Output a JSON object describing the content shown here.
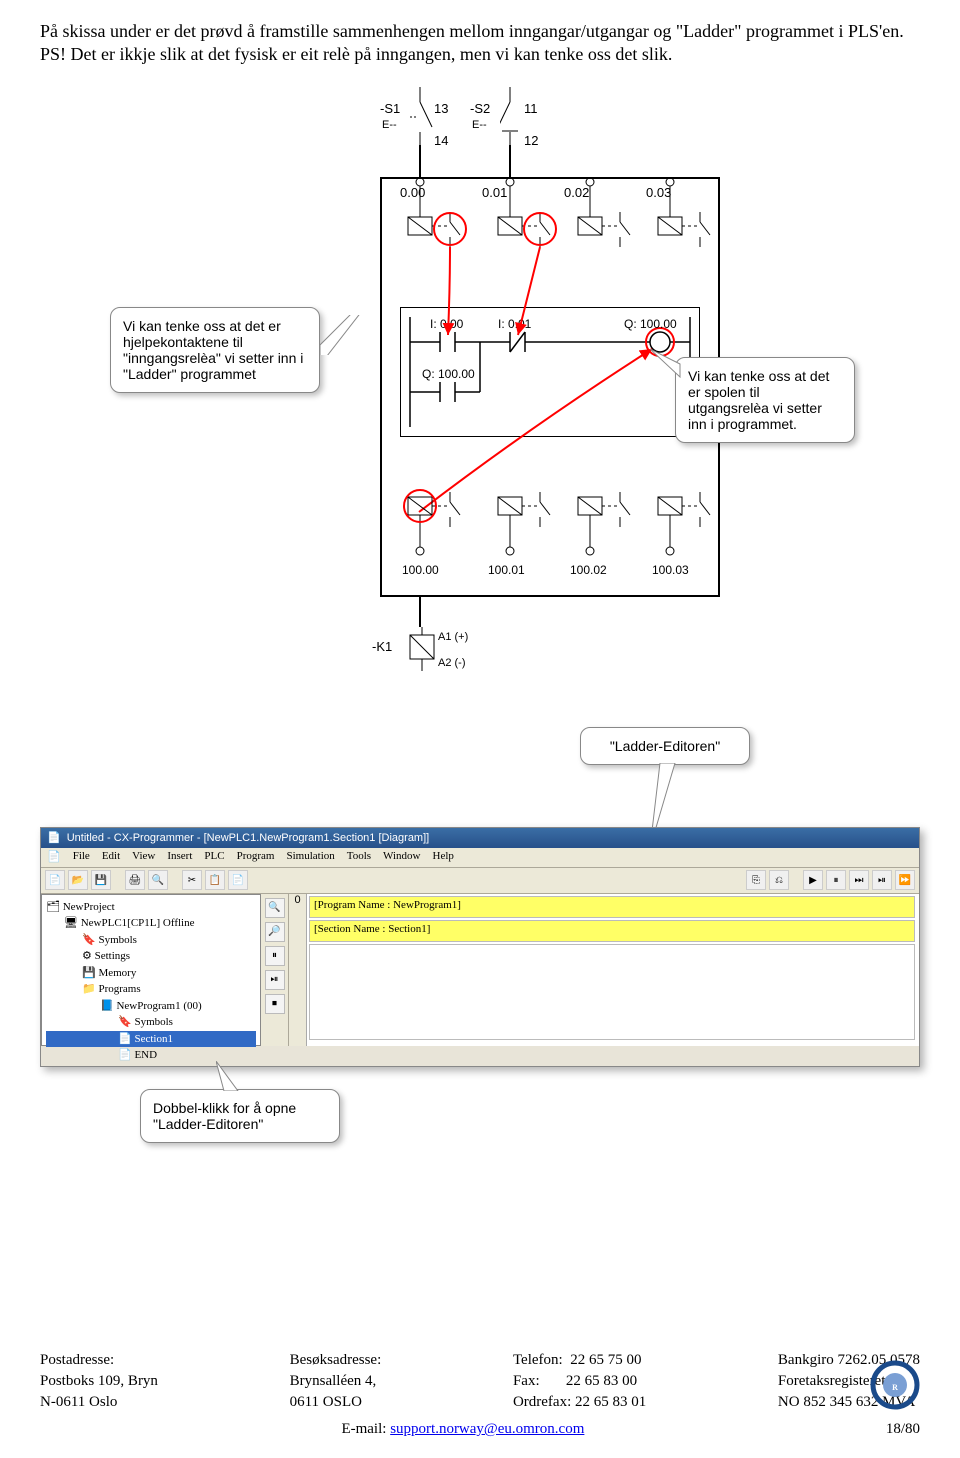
{
  "intro": {
    "p1": "På skissa under er det prøvd å framstille sammenhengen mellom inngangar/utgangar og \"Ladder\" programmet i PLS'en.",
    "p2": "PS! Det er ikkje slik at det fysisk er eit relè på inngangen, men vi kan tenke oss det slik."
  },
  "circuit": {
    "top_switches": [
      {
        "name": "-S1",
        "pins": [
          "13",
          "14"
        ],
        "sym": "E--"
      },
      {
        "name": "-S2",
        "pins": [
          "11",
          "12"
        ],
        "sym": "E--"
      }
    ],
    "input_terminals": [
      "0.00",
      "0.01",
      "0.02",
      "0.03"
    ],
    "output_terminals": [
      "100.00",
      "100.01",
      "100.02",
      "100.03"
    ],
    "ladder": {
      "contacts": [
        "I: 0.00",
        "I: 0.01"
      ],
      "coil": "Q: 100.00",
      "branch_contact": "Q: 100.00"
    },
    "bottom_device": {
      "name": "-K1",
      "pins": [
        "A1 (+)",
        "A2 (-)"
      ]
    }
  },
  "callouts": {
    "left": "Vi kan tenke oss at det er hjelpekontaktene til \"inngangsrelèa\" vi setter inn i \"Ladder\" programmet",
    "right": "Vi kan tenke oss at det er spolen til utgangsrelèa vi setter inn i programmet.",
    "editor": "\"Ladder-Editoren\"",
    "dblclick": "Dobbel-klikk for å opne \"Ladder-Editoren\""
  },
  "screenshot": {
    "title": "Untitled - CX-Programmer - [NewPLC1.NewProgram1.Section1 [Diagram]]",
    "menus": [
      "File",
      "Edit",
      "View",
      "Insert",
      "PLC",
      "Program",
      "Simulation",
      "Tools",
      "Window",
      "Help"
    ],
    "tree": {
      "root": "NewProject",
      "plc": "NewPLC1[CP1L] Offline",
      "nodes": [
        "Symbols",
        "Settings",
        "Memory",
        "Programs"
      ],
      "program": "NewProgram1 (00)",
      "prog_children": [
        "Symbols",
        "Section1",
        "END"
      ]
    },
    "editor": {
      "gutter": "0",
      "row1": "[Program Name : NewProgram1]",
      "row2": "[Section Name : Section1]"
    }
  },
  "footer": {
    "col1_label": "Postadresse:",
    "col1_l1": "Postboks 109, Bryn",
    "col1_l2": "N-0611 Oslo",
    "col2_label": "Besøksadresse:",
    "col2_l1": "Brynsalléen 4,",
    "col2_l2": "0611 OSLO",
    "col3_tel_label": "Telefon:",
    "col3_tel": "22 65 75 00",
    "col3_fax_label": "Fax:",
    "col3_fax": "22 65 83 00",
    "col3_ord_label": "Ordrefax:",
    "col3_ord": "22 65 83 01",
    "col4_bank_label": "Bankgiro",
    "col4_bank": "7262.05.0578",
    "col4_reg_label": "Foretaksregisteret:",
    "col4_reg": "NO 852 345 632 MVA",
    "email_label": "E-mail:",
    "email": "support.norway@eu.omron.com",
    "page": "18/80"
  }
}
